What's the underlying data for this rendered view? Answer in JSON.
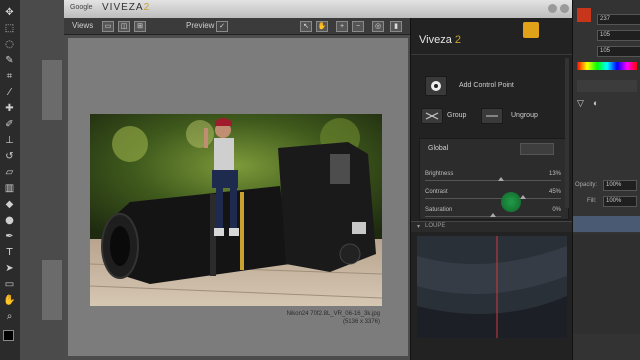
{
  "app": {
    "brand": "Google",
    "product": "VIVEZA",
    "product_version": "2"
  },
  "toolbar": {
    "views_label": "Views",
    "preview_label": "Preview"
  },
  "image": {
    "filename": "Nikon24 70f2.8L_VR_06-16_3k.jpg",
    "dimensions": "(5136 x 3376)"
  },
  "panel": {
    "title": "Viveza",
    "version": "2",
    "add_control_point": "Add Control Point",
    "group": "Group",
    "ungroup": "Ungroup",
    "global": "Global",
    "sliders": [
      {
        "label": "Brightness",
        "value": "13%",
        "level": 0.56
      },
      {
        "label": "Contrast",
        "value": "45%",
        "level": 0.72
      },
      {
        "label": "Saturation",
        "value": "0%",
        "level": 0.5
      }
    ],
    "loupe": "LOUPE"
  },
  "ps_right": {
    "values": [
      "237",
      "105",
      "105"
    ],
    "opacity_label": "Opacity:",
    "opacity_value": "100%",
    "fill_label": "Fill:",
    "fill_value": "100%"
  },
  "colors": {
    "accent": "#c8a232",
    "nik": "#e0a218",
    "swatch": "#c7361b"
  }
}
